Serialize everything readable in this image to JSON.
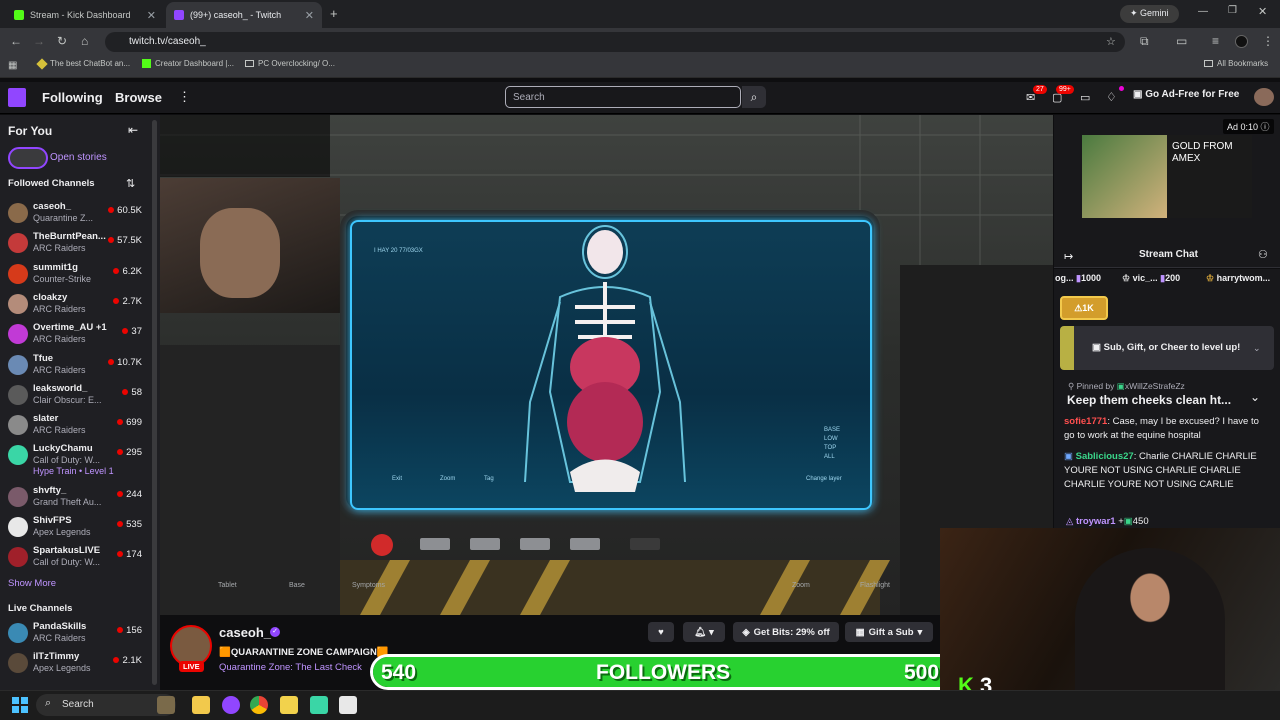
{
  "browser": {
    "tabs": [
      {
        "title": "Stream - Kick Dashboard",
        "color": "#53fc18"
      },
      {
        "title": "(99+) caseoh_ - Twitch",
        "color": "#9146ff"
      }
    ],
    "gemini_label": "Gemini",
    "url": "twitch.tv/caseoh_",
    "bookmarks": [
      "The best ChatBot an...",
      "Creator Dashboard |...",
      "PC Overclocking/ O..."
    ],
    "all_bookmarks": "All Bookmarks"
  },
  "twitch_nav": {
    "following": "Following",
    "browse": "Browse",
    "search_placeholder": "Search",
    "notif_count": "27",
    "whisper_count": "99+",
    "ad_free": "Go Ad-Free for Free"
  },
  "sidebar": {
    "for_you": "For You",
    "open_stories": "Open stories",
    "followed_header": "Followed Channels",
    "channels": [
      {
        "name": "caseoh_",
        "game": "Quarantine Z...",
        "viewers": "60.5K",
        "color": "#8a6a4a"
      },
      {
        "name": "TheBurntPean...",
        "game": "ARC Raiders",
        "viewers": "57.5K",
        "color": "#c43a3a"
      },
      {
        "name": "summit1g",
        "game": "Counter-Strike",
        "viewers": "6.2K",
        "color": "#d63a1a"
      },
      {
        "name": "cloakzy",
        "game": "ARC Raiders",
        "viewers": "2.7K",
        "color": "#b48c7a"
      },
      {
        "name": "Overtime_AU +1",
        "game": "ARC Raiders",
        "viewers": "37",
        "color": "#c13ad6"
      },
      {
        "name": "Tfue",
        "game": "ARC Raiders",
        "viewers": "10.7K",
        "color": "#6a8ab4"
      },
      {
        "name": "leaksworld_",
        "game": "Clair Obscur: E...",
        "viewers": "58",
        "color": "#5a5a5a"
      },
      {
        "name": "slater",
        "game": "ARC Raiders",
        "viewers": "699",
        "color": "#8a8a8a"
      },
      {
        "name": "LuckyChamu",
        "game": "Call of Duty: W...",
        "viewers": "295",
        "color": "#3ad6a6",
        "hype": "Hype Train • Level 1"
      },
      {
        "name": "shvfty_",
        "game": "Grand Theft Au...",
        "viewers": "244",
        "color": "#7a5a6a"
      },
      {
        "name": "ShivFPS",
        "game": "Apex Legends",
        "viewers": "535",
        "color": "#e8e8e8"
      },
      {
        "name": "SpartakusLIVE",
        "game": "Call of Duty: W...",
        "viewers": "174",
        "color": "#a0202a"
      }
    ],
    "show_more": "Show More",
    "live_header": "Live Channels",
    "live_channels": [
      {
        "name": "PandaSkills",
        "game": "ARC Raiders",
        "viewers": "156",
        "color": "#3a8ab4"
      },
      {
        "name": "iITzTimmy",
        "game": "Apex Legends",
        "viewers": "2.1K",
        "color": "#5a4a3a"
      }
    ]
  },
  "video": {
    "screen_header": "I HAY 20 77/03GX",
    "base_options": [
      "BASE",
      "LOW",
      "TOP",
      "ALL"
    ],
    "screen_controls": [
      "Exit",
      "Zoom",
      "Tag",
      "Change layer"
    ],
    "bottom_hints": [
      "Tablet",
      "Base",
      "Symptoms",
      "Zoom",
      "Flashlight"
    ]
  },
  "stream_info": {
    "channel": "caseoh_",
    "title": "🟧QUARANTINE ZONE CAMPAIGN🟧",
    "category": "Quarantine Zone: The Last Check",
    "live": "LIVE",
    "get_bits": "Get Bits: 29% off",
    "gift_sub": "Gift a Sub"
  },
  "followers_overlay": {
    "current": "540",
    "label": "FOLLOWERS",
    "goal": "500"
  },
  "ad": {
    "label": "Ad 0:10",
    "text": "GOLD FROM AMEX"
  },
  "chat": {
    "title": "Stream Chat",
    "gift_leaders": [
      {
        "name": "og...",
        "amount": "1000"
      },
      {
        "name": "vic_...",
        "amount": "200"
      },
      {
        "name": "harrytwom...",
        "amount": ""
      }
    ],
    "hype_pill": "1K",
    "hype_prompt": "Sub, Gift, or Cheer to level up!",
    "pinned_by": "Pinned by",
    "pinned_user": "xWillZeStrafeZz",
    "pinned_message": "Keep them cheeks clean ht...",
    "messages": [
      {
        "user": "sofie1771",
        "text": ": Case, may I be excused? I have to go to work at the equine hospital",
        "color": "#ff4f4f"
      },
      {
        "user": "Sablicious27",
        "text": ": Charlie CHARLIE CHARLIE YOURE NOT USING CHARLIE CHARLIE CHARLIE YOURE NOT USING CARLIE",
        "color": "#3ad68a"
      }
    ],
    "cheer_user": "troywar1",
    "cheer_amount": "450"
  },
  "webcam_overlay": {
    "kick_count": "3"
  },
  "taskbar": {
    "search": "Search"
  }
}
